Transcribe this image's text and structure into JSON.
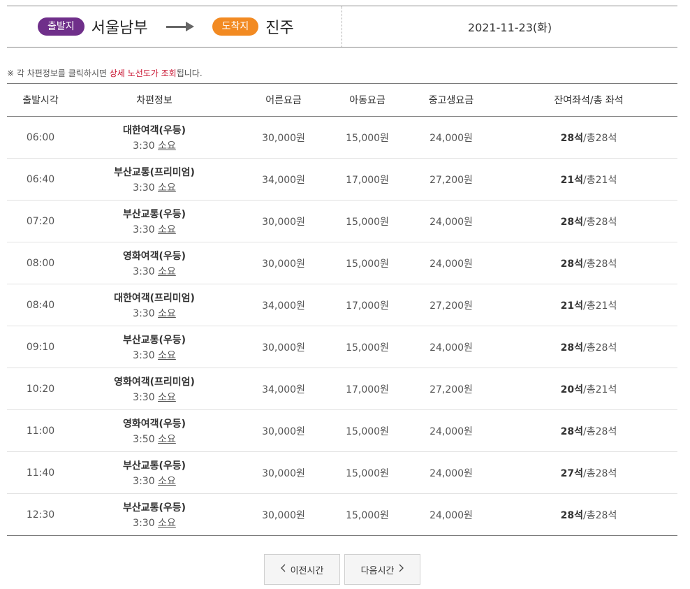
{
  "route": {
    "departure_label": "출발지",
    "departure_city": "서울남부",
    "arrival_label": "도착지",
    "arrival_city": "진주",
    "date": "2021-11-23(화)",
    "colors": {
      "departure_pill": "#6f2f8a",
      "arrival_pill": "#f28a22"
    }
  },
  "notice": {
    "prefix": "※ 각 차편정보를 클릭하시면 ",
    "highlight": "상세 노선도가 조회",
    "suffix": "됩니다."
  },
  "table": {
    "headers": [
      "출발시각",
      "차편정보",
      "어른요금",
      "아동요금",
      "중고생요금",
      "잔여좌석/총 좌석"
    ],
    "rows": [
      {
        "time": "06:00",
        "company": "대한여객(우등)",
        "duration": "3:30",
        "duration_suffix": "소요",
        "adult": "30,000원",
        "child": "15,000원",
        "student": "24,000원",
        "remaining": "28석",
        "total": "/총28석"
      },
      {
        "time": "06:40",
        "company": "부산교통(프리미엄)",
        "duration": "3:30",
        "duration_suffix": "소요",
        "adult": "34,000원",
        "child": "17,000원",
        "student": "27,200원",
        "remaining": "21석",
        "total": "/총21석"
      },
      {
        "time": "07:20",
        "company": "부산교통(우등)",
        "duration": "3:30",
        "duration_suffix": "소요",
        "adult": "30,000원",
        "child": "15,000원",
        "student": "24,000원",
        "remaining": "28석",
        "total": "/총28석"
      },
      {
        "time": "08:00",
        "company": "영화여객(우등)",
        "duration": "3:30",
        "duration_suffix": "소요",
        "adult": "30,000원",
        "child": "15,000원",
        "student": "24,000원",
        "remaining": "28석",
        "total": "/총28석"
      },
      {
        "time": "08:40",
        "company": "대한여객(프리미엄)",
        "duration": "3:30",
        "duration_suffix": "소요",
        "adult": "34,000원",
        "child": "17,000원",
        "student": "27,200원",
        "remaining": "21석",
        "total": "/총21석"
      },
      {
        "time": "09:10",
        "company": "부산교통(우등)",
        "duration": "3:30",
        "duration_suffix": "소요",
        "adult": "30,000원",
        "child": "15,000원",
        "student": "24,000원",
        "remaining": "28석",
        "total": "/총28석"
      },
      {
        "time": "10:20",
        "company": "영화여객(프리미엄)",
        "duration": "3:30",
        "duration_suffix": "소요",
        "adult": "34,000원",
        "child": "17,000원",
        "student": "27,200원",
        "remaining": "20석",
        "total": "/총21석"
      },
      {
        "time": "11:00",
        "company": "영화여객(우등)",
        "duration": "3:50",
        "duration_suffix": "소요",
        "adult": "30,000원",
        "child": "15,000원",
        "student": "24,000원",
        "remaining": "28석",
        "total": "/총28석"
      },
      {
        "time": "11:40",
        "company": "부산교통(우등)",
        "duration": "3:30",
        "duration_suffix": "소요",
        "adult": "30,000원",
        "child": "15,000원",
        "student": "24,000원",
        "remaining": "27석",
        "total": "/총28석"
      },
      {
        "time": "12:30",
        "company": "부산교통(우등)",
        "duration": "3:30",
        "duration_suffix": "소요",
        "adult": "30,000원",
        "child": "15,000원",
        "student": "24,000원",
        "remaining": "28석",
        "total": "/총28석"
      }
    ]
  },
  "pager": {
    "prev_label": "이전시간",
    "next_label": "다음시간",
    "prev_icon": "chevron-left-icon",
    "next_icon": "chevron-right-icon"
  }
}
